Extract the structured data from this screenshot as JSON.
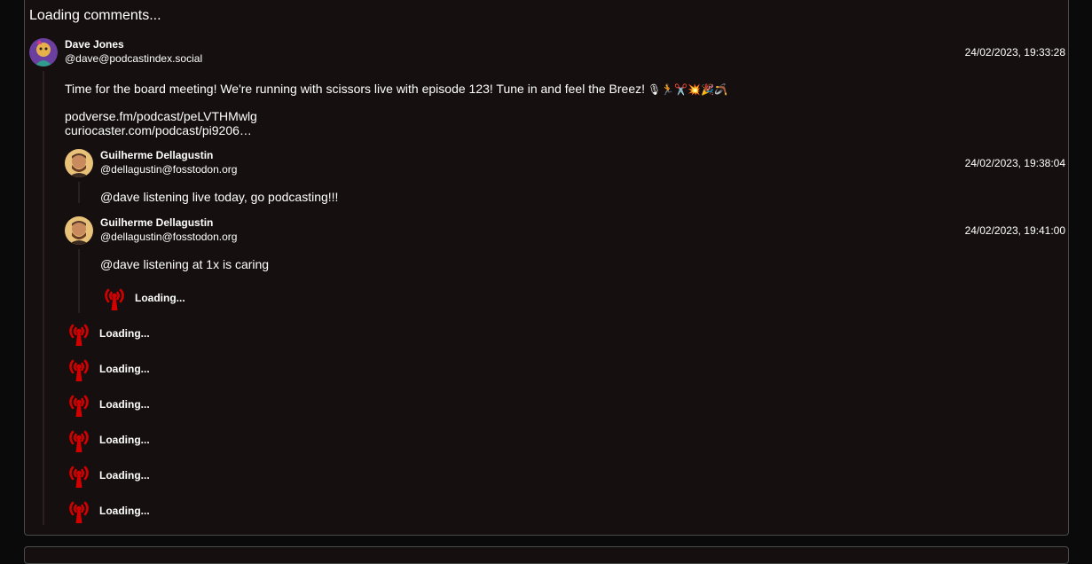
{
  "header": {
    "loading_comments": "Loading comments..."
  },
  "colors": {
    "panel_bg": "#150f0f",
    "loader_red": "#d40000",
    "text": "#ffffff"
  },
  "root_comment": {
    "author_name": "Dave Jones",
    "author_handle": "@dave@podcastindex.social",
    "timestamp": "24/02/2023, 19:33:28",
    "body": "Time for the board meeting! We're running with scissors live with episode 123! Tune in and feel the Breez!",
    "emojis": "🎙🏃✂️💥🎉🪃",
    "links": [
      "podverse.fm/podcast/peLVTHMwlg",
      "curiocaster.com/podcast/pi9206…"
    ],
    "avatar_icon": "avatar-icon"
  },
  "replies": [
    {
      "author_name": "Guilherme Dellagustin",
      "author_handle": "@dellagustin@fosstodon.org",
      "timestamp": "24/02/2023, 19:38:04",
      "body": "@dave listening live today, go podcasting!!!"
    },
    {
      "author_name": "Guilherme Dellagustin",
      "author_handle": "@dellagustin@fosstodon.org",
      "timestamp": "24/02/2023, 19:41:00",
      "body": "@dave listening at 1x is caring",
      "nested_loader": "Loading..."
    }
  ],
  "loaders": [
    "Loading...",
    "Loading...",
    "Loading...",
    "Loading...",
    "Loading...",
    "Loading..."
  ],
  "loader_icon": "podcast-antenna-icon"
}
